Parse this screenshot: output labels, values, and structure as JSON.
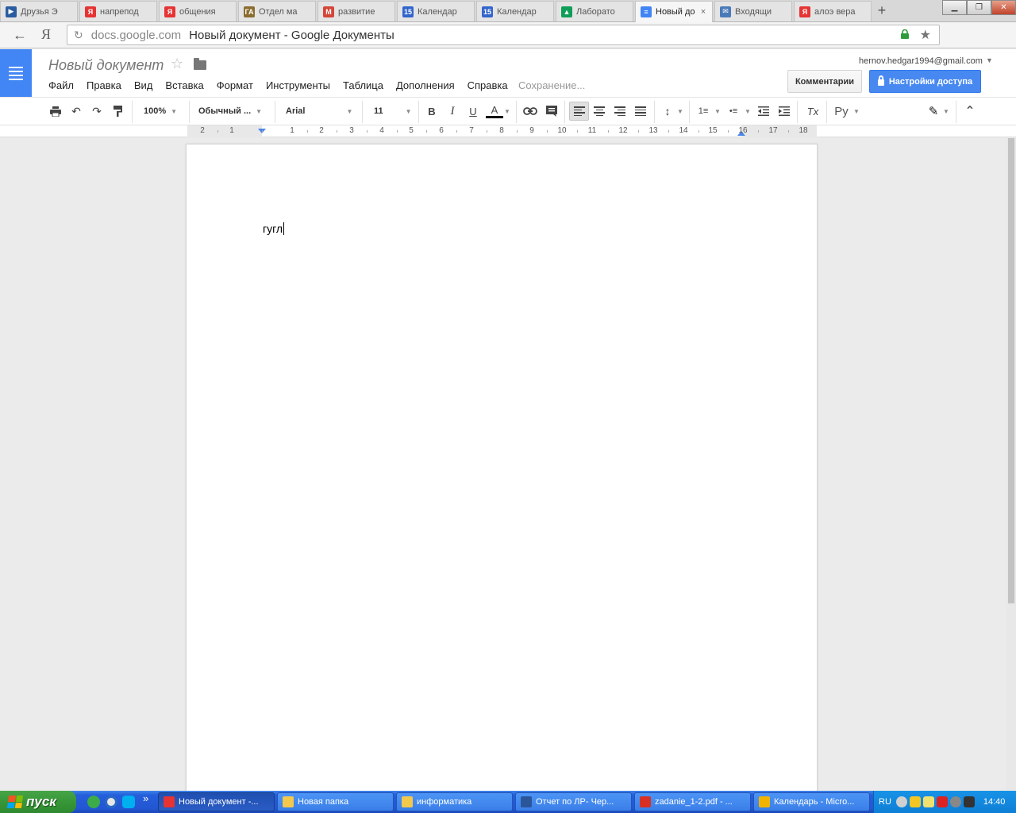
{
  "browser": {
    "tabs": [
      {
        "label": "Друзья Э",
        "color": "#2a5d9f",
        "glyph": "▶"
      },
      {
        "label": "напрепод",
        "color": "#e63333",
        "glyph": "Я"
      },
      {
        "label": "общения",
        "color": "#e63333",
        "glyph": "Я"
      },
      {
        "label": "Отдел ма",
        "color": "#8a6d2f",
        "glyph": "ГА"
      },
      {
        "label": "развитие",
        "color": "#d44638",
        "glyph": "M"
      },
      {
        "label": "Календар",
        "color": "#3366cc",
        "glyph": "15"
      },
      {
        "label": "Календар",
        "color": "#3366cc",
        "glyph": "15"
      },
      {
        "label": "Лаборато",
        "color": "#0f9d58",
        "glyph": "▲"
      },
      {
        "label": "Новый до",
        "color": "#4285f4",
        "glyph": "≡"
      },
      {
        "label": "Входящи",
        "color": "#4a7ab8",
        "glyph": "✉"
      },
      {
        "label": "алоэ вера",
        "color": "#e63333",
        "glyph": "Я"
      }
    ],
    "active_tab_close": "×",
    "new_tab": "+",
    "window_buttons": {
      "minimize": "▁",
      "restore": "❐",
      "close": "✕"
    },
    "address": {
      "domain": "docs.google.com",
      "page_title": "Новый документ - Google Документы",
      "reload": "↻",
      "back": "←",
      "yandex": "Я",
      "star": "★",
      "download": "⤓"
    },
    "accent": "#4285f4"
  },
  "docs": {
    "title": "Новый документ",
    "star": "☆",
    "menu": [
      "Файл",
      "Правка",
      "Вид",
      "Вставка",
      "Формат",
      "Инструменты",
      "Таблица",
      "Дополнения",
      "Справка"
    ],
    "saving_status": "Сохранение...",
    "account": "hernov.hedgar1994@gmail.com",
    "account_caret": "▼",
    "comments_button": "Комментарии",
    "share_button": "Настройки доступа"
  },
  "toolbar": {
    "zoom": "100%",
    "style": "Обычный ...",
    "font": "Arial",
    "size": "11",
    "bold": "B",
    "italic": "I",
    "underline": "U",
    "text_color": "A",
    "input_tools": "Ру",
    "caret": "▼",
    "print": "🖶",
    "undo": "↶",
    "redo": "↷",
    "link": "🔗",
    "comment": "▤",
    "line_spacing": "↕",
    "numbered_list": "1≡",
    "bulleted_list": "•≡",
    "clear_format": "Tx",
    "edit_mode": "✎",
    "collapse": "⌃"
  },
  "ruler": {
    "labels": [
      "2",
      "1",
      "1",
      "2",
      "3",
      "4",
      "5",
      "6",
      "7",
      "8",
      "9",
      "10",
      "11",
      "12",
      "13",
      "14",
      "15",
      "16",
      "17",
      "18"
    ]
  },
  "document": {
    "text": "гугл"
  },
  "taskbar": {
    "start_label": "пуск",
    "more": "»",
    "tasks": [
      {
        "label": "Новый документ -...",
        "color": "#e63333",
        "active": true
      },
      {
        "label": "Новая папка",
        "color": "#f2c94c",
        "active": false
      },
      {
        "label": "информатика",
        "color": "#f2c94c",
        "active": false
      },
      {
        "label": "Отчет по ЛР- Чер...",
        "color": "#2b579a",
        "active": false
      },
      {
        "label": "zadanie_1-2.pdf - ...",
        "color": "#d93025",
        "active": false
      },
      {
        "label": "Календарь - Micro...",
        "color": "#f0b400",
        "active": false
      }
    ],
    "language": "RU",
    "clock": "14:40"
  }
}
